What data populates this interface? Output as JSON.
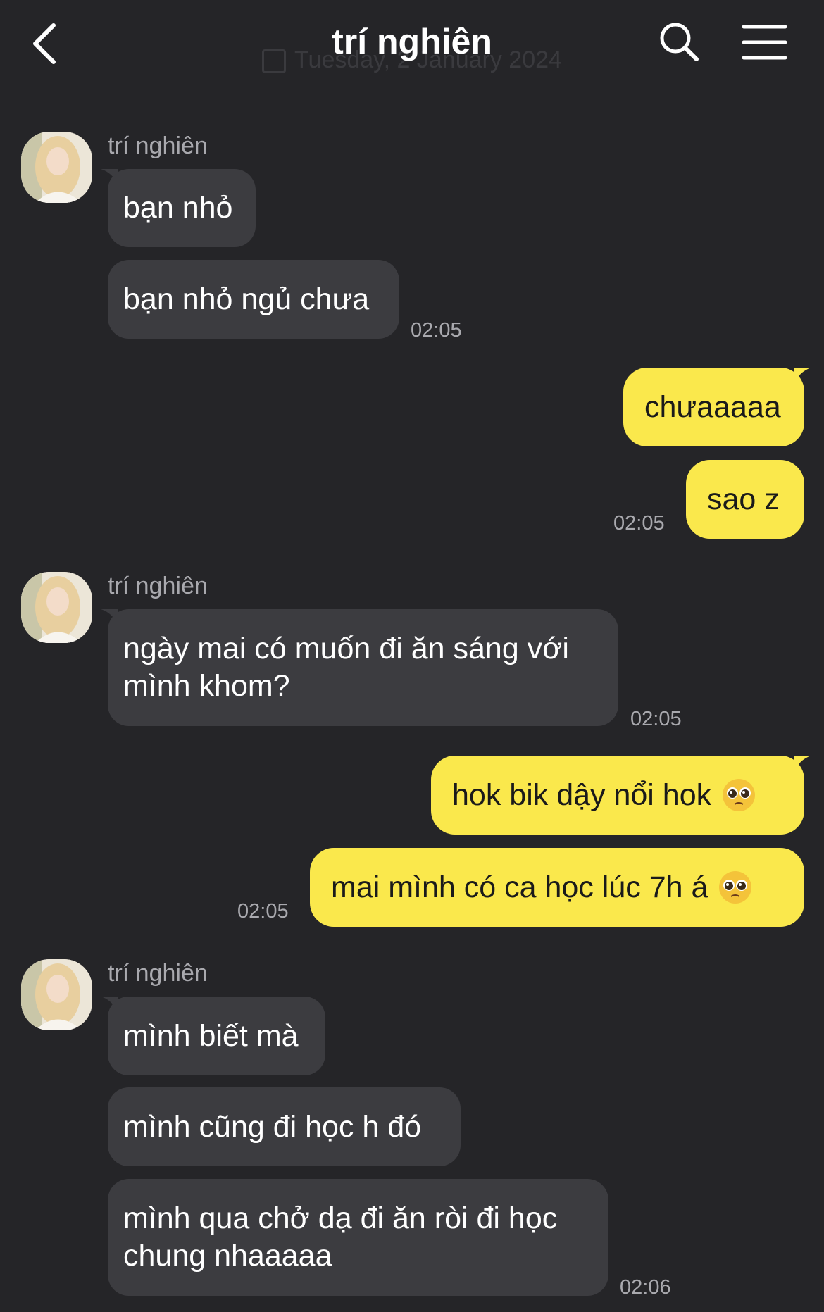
{
  "header": {
    "title": "trí nghiên",
    "date_banner": "Tuesday, 2 January 2024"
  },
  "messages": [
    {
      "dir": "in",
      "sender": "trí nghiên",
      "text": "bạn nhỏ"
    },
    {
      "dir": "in",
      "text": "bạn nhỏ ngủ chưa",
      "time": "02:05"
    },
    {
      "dir": "out",
      "text": "chưaaaaa"
    },
    {
      "dir": "out",
      "text": "sao z",
      "time": "02:05"
    },
    {
      "dir": "in",
      "sender": "trí nghiên",
      "text_line1": "ngày mai có muốn đi ăn sáng với",
      "text_line2": "mình khom?",
      "time": "02:05"
    },
    {
      "dir": "out",
      "text": "hok bik dậy nổi hok",
      "emoji": "pleading-face-emoji"
    },
    {
      "dir": "out",
      "text": "mai mình có ca học lúc 7h á",
      "emoji": "pleading-face-emoji",
      "time": "02:05"
    },
    {
      "dir": "in",
      "sender": "trí nghiên",
      "text": "mình biết mà"
    },
    {
      "dir": "in",
      "text": "mình cũng đi học h đó"
    },
    {
      "dir": "in",
      "text_line1": "mình qua chở dạ đi ăn ròi đi học",
      "text_line2": "chung nhaaaaa",
      "time": "02:06"
    }
  ],
  "colors": {
    "background": "#252528",
    "incoming_bubble": "#3c3c40",
    "outgoing_bubble": "#fae84c",
    "meta_text": "#a9a9ae"
  },
  "icons": {
    "back": "chevron-left-icon",
    "search": "search-icon",
    "menu": "hamburger-menu-icon"
  }
}
